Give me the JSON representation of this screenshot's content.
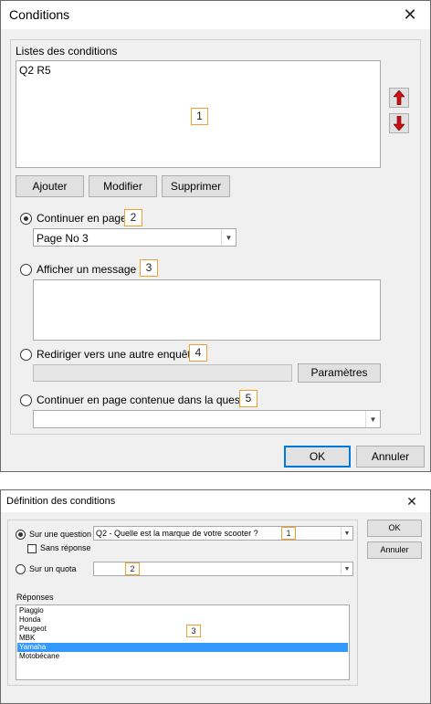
{
  "dialog1": {
    "title": "Conditions",
    "close_glyph": "✕",
    "list_label": "Listes des conditions",
    "conditions": [
      "Q2 R5"
    ],
    "annotations": [
      "1",
      "2",
      "3",
      "4",
      "5"
    ],
    "buttons": {
      "add": "Ajouter",
      "edit": "Modifier",
      "delete": "Supprimer"
    },
    "option_continue_page": {
      "label": "Continuer en page",
      "selected_value": "Page No 3",
      "checked": true
    },
    "option_show_message": {
      "label": "Afficher un message :",
      "value": ""
    },
    "option_redirect": {
      "label": "Rediriger vers une autre enquête",
      "value": "",
      "params_button": "Paramètres"
    },
    "option_continue_in_question": {
      "label": "Continuer en page contenue dans la question",
      "value": ""
    },
    "ok": "OK",
    "cancel": "Annuler",
    "icons": {
      "up": "arrow-up-icon",
      "down": "arrow-down-icon"
    },
    "arrow_color": "#d01010"
  },
  "dialog2": {
    "title": "Définition des conditions",
    "close_glyph": "✕",
    "question_option_label": "Sur une question",
    "question_value": "Q2 - Quelle est la marque de votre scooter ?",
    "no_response_label": "Sans réponse",
    "quota_option_label": "Sur un quota",
    "quota_value": "",
    "responses_label": "Réponses",
    "responses": [
      "Piaggio",
      "Honda",
      "Peugeot",
      "MBK",
      "Yamaha",
      "Motobécane"
    ],
    "selected_response": "Yamaha",
    "annotations": [
      "1",
      "2",
      "3"
    ],
    "ok": "OK",
    "cancel": "Annuler",
    "selection_color": "#3399ff"
  }
}
